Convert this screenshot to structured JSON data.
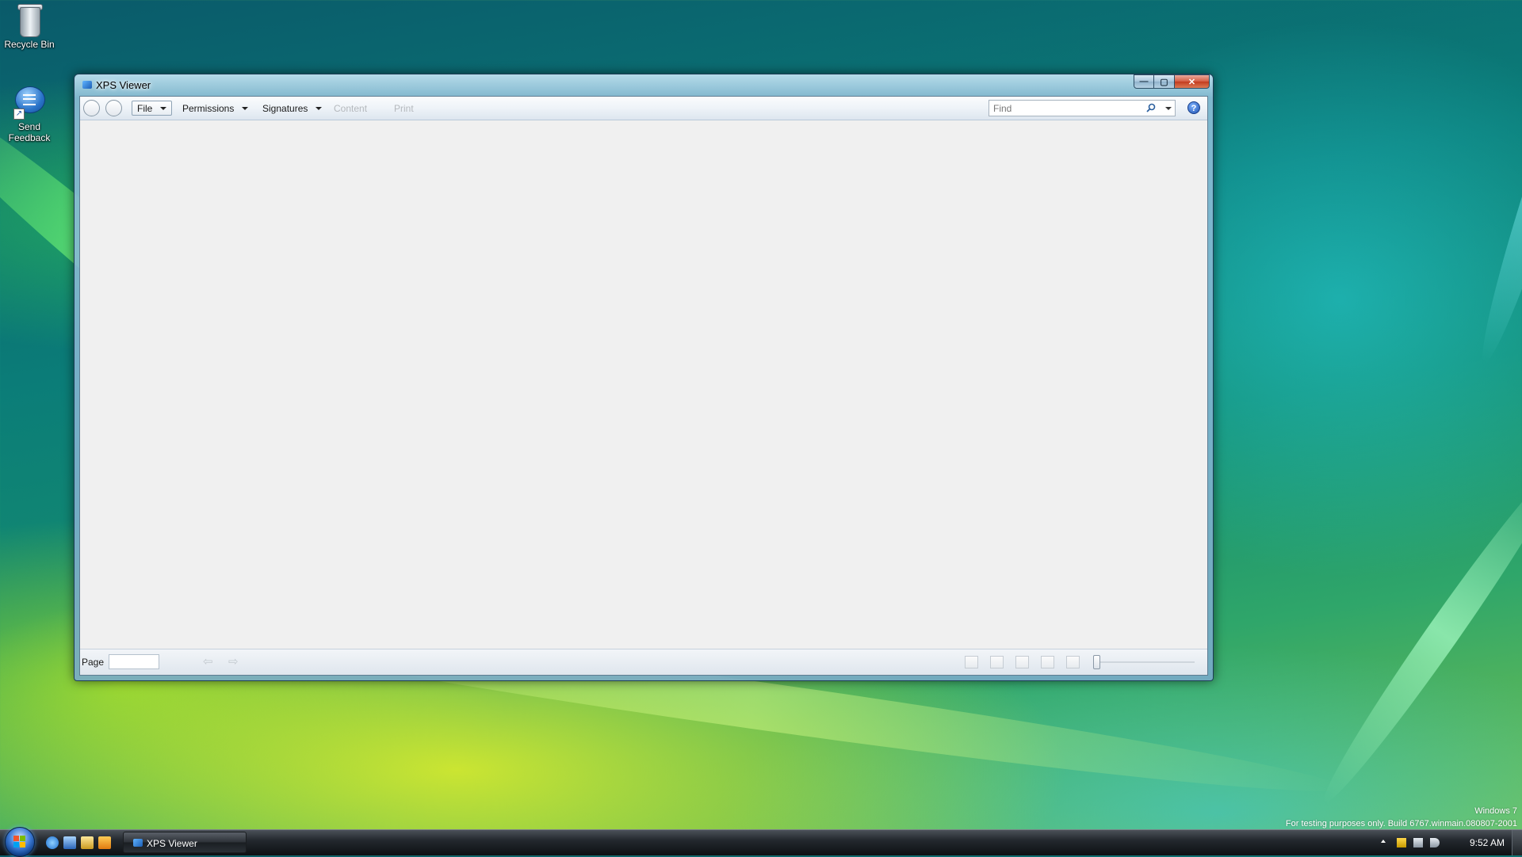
{
  "desktop": {
    "icons": [
      {
        "label": "Recycle Bin"
      },
      {
        "label": "Send Feedback"
      }
    ]
  },
  "window": {
    "title": "XPS Viewer",
    "caption": {
      "minimize": "—",
      "maximize": "▢",
      "close": "✕"
    },
    "toolbar": {
      "menus": [
        {
          "label": "File",
          "enabled": true
        },
        {
          "label": "Permissions",
          "enabled": true
        },
        {
          "label": "Signatures",
          "enabled": true
        },
        {
          "label": "Content",
          "enabled": false
        },
        {
          "label": "Print",
          "enabled": false
        }
      ],
      "find": {
        "placeholder": "Find",
        "value": ""
      },
      "help": "?"
    },
    "statusbar": {
      "page_label": "Page",
      "page_value": "",
      "prev_arrow": "⇦",
      "next_arrow": "⇨",
      "zoom_fraction": 0.0
    }
  },
  "watermark": {
    "line1": "Windows 7",
    "line2": "For testing purposes only. Build 6767.winmain.080807-2001"
  },
  "taskbar": {
    "task_buttons": [
      {
        "label": "XPS Viewer"
      }
    ],
    "clock": "9:52 AM"
  },
  "colors": {
    "accent": "#1b5eb5",
    "close": "#c23b1f",
    "client_bg": "#f0f0f0"
  }
}
